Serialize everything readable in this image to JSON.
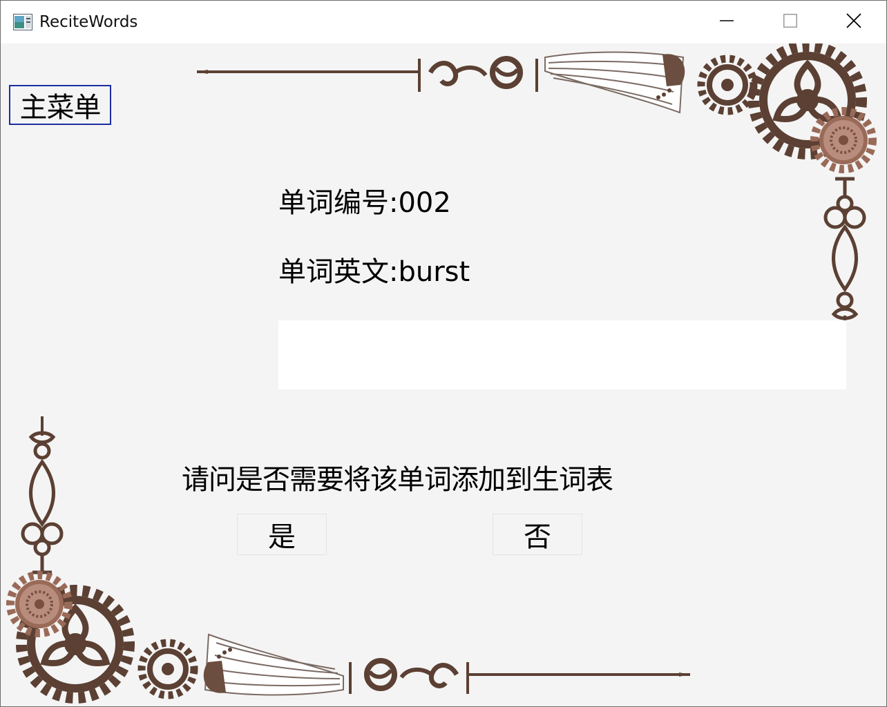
{
  "window": {
    "title": "ReciteWords",
    "icon": "app-window-icon",
    "controls": [
      "minimize-icon",
      "maximize-icon",
      "close-icon"
    ]
  },
  "main_menu": {
    "label": "主菜单"
  },
  "word": {
    "id_label": "单词编号:002",
    "english_label": "单词英文:burst"
  },
  "meaning_input": {
    "value": ""
  },
  "prompt": {
    "text": "请问是否需要将该单词添加到生词表"
  },
  "choices": {
    "yes_label": "是",
    "no_label": "否"
  },
  "colors": {
    "ornament_brown": "#5b4033",
    "ornament_copper": "#9a6a58",
    "background": "#f4f4f4",
    "focus_border": "#1a2ea0"
  }
}
